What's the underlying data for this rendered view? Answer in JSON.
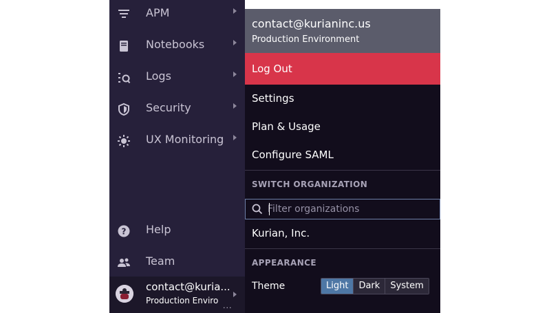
{
  "sidebar": {
    "items": [
      {
        "label": "APM",
        "icon": "apm-icon"
      },
      {
        "label": "Notebooks",
        "icon": "notebook-icon"
      },
      {
        "label": "Logs",
        "icon": "logs-icon"
      },
      {
        "label": "Security",
        "icon": "shield-icon"
      },
      {
        "label": "UX Monitoring",
        "icon": "ux-monitoring-icon"
      }
    ],
    "bottom_items": [
      {
        "label": "Help",
        "icon": "help-icon"
      },
      {
        "label": "Team",
        "icon": "team-icon"
      }
    ],
    "user": {
      "name": "contact@kuria...",
      "environment": "Production Enviro",
      "dots": "..."
    }
  },
  "menu": {
    "email": "contact@kurianinc.us",
    "environment": "Production Environment",
    "logout_label": "Log Out",
    "items": [
      "Settings",
      "Plan & Usage",
      "Configure SAML"
    ],
    "switch_org_label": "SWITCH ORGANIZATION",
    "filter_placeholder": "Filter organizations",
    "orgs": [
      "Kurian, Inc."
    ],
    "appearance_label": "APPEARANCE",
    "theme_label": "Theme",
    "theme_options": [
      "Light",
      "Dark",
      "System"
    ],
    "theme_selected": "Light"
  },
  "colors": {
    "sidebar_bg": "#26203a",
    "menu_bg": "#120d1c",
    "header_bg": "#5b5c6b",
    "logout_bg": "#d8354a",
    "accent": "#4e77a5"
  }
}
